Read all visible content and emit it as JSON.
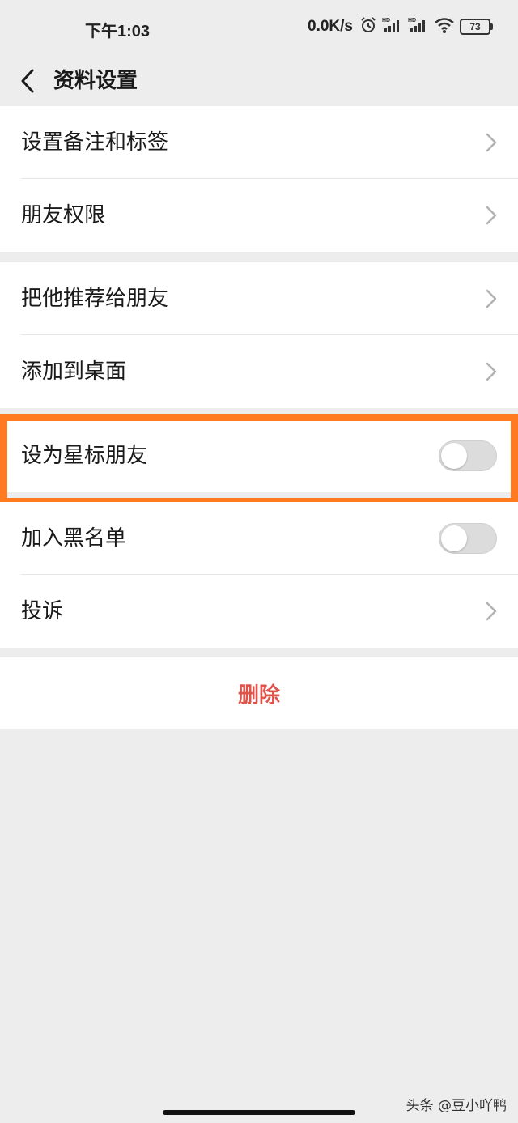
{
  "status_bar": {
    "time": "下午1:03",
    "net_speed": "0.0K/s",
    "battery": "73",
    "icons": [
      "alarm-icon",
      "signal-hd-icon",
      "signal-hd-icon",
      "wifi-icon",
      "battery-icon"
    ]
  },
  "nav": {
    "title": "资料设置"
  },
  "groups": {
    "group1": [
      "设置备注和标签",
      "朋友权限"
    ],
    "group2": [
      "把他推荐给朋友",
      "添加到桌面"
    ],
    "group3": [
      "设为星标朋友"
    ],
    "group4": [
      "加入黑名单",
      "投诉"
    ]
  },
  "toggles": {
    "star_friend": false,
    "blacklist": false
  },
  "delete_label": "删除",
  "watermark": "头条 @豆小吖鸭",
  "colors": {
    "accent_delete": "#e0534b",
    "highlight": "#ff7a21",
    "background": "#ededed"
  }
}
